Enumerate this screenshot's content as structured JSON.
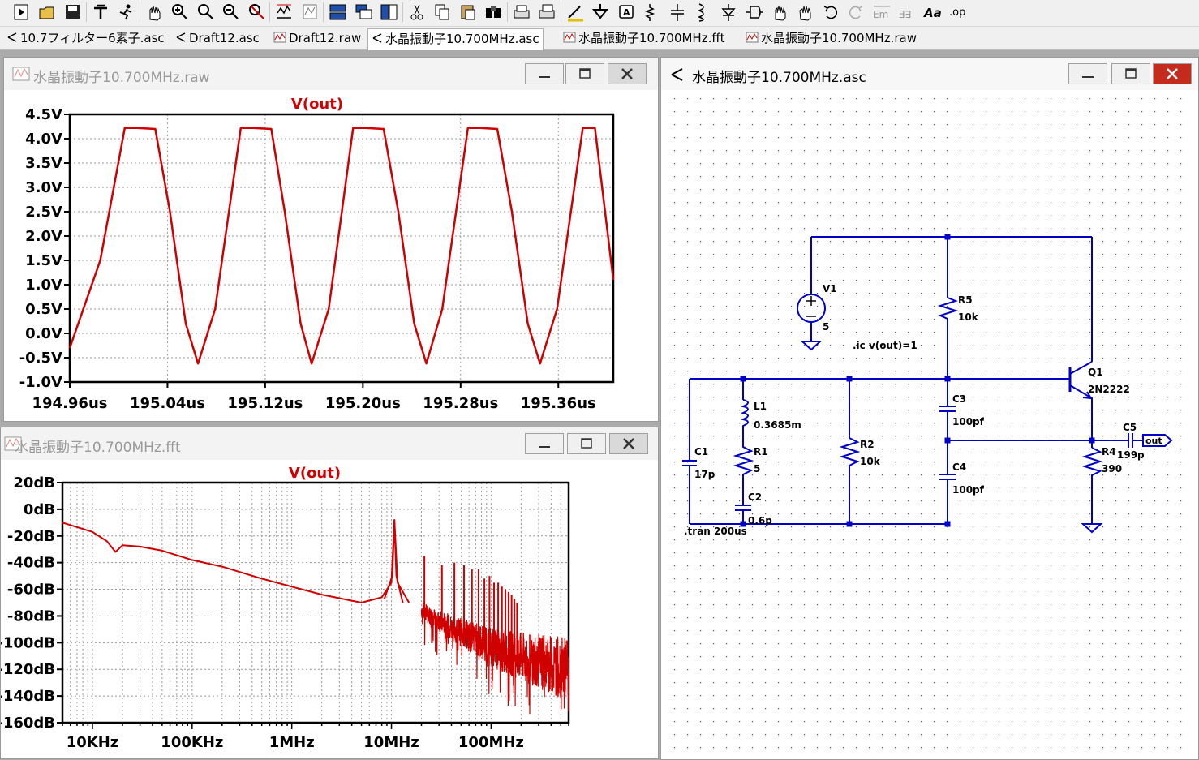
{
  "toolbar": {
    "buttons": [
      "run-icon",
      "open-icon",
      "save-icon",
      "control-panel-icon",
      "run-sim-icon",
      "pan-icon",
      "zoom-in-icon",
      "zoom-area-icon",
      "zoom-out-icon",
      "zoom-cancel-icon",
      "autorange-icon",
      "wave-icon",
      "tile-horizontal-icon",
      "cascade-icon",
      "tile-vertical-icon",
      "cut-icon",
      "copy-icon",
      "paste-icon",
      "find-icon",
      "print-icon",
      "print-setup-icon",
      "wire-icon",
      "ground-icon",
      "label-icon",
      "resistor-icon",
      "capacitor-icon",
      "inductor-icon",
      "diode-icon",
      "component-icon",
      "move-icon",
      "drag-icon",
      "undo-icon",
      "redo-icon",
      "rotate-icon",
      "mirror-icon",
      "text-icon",
      "spice-directive-icon"
    ],
    "text_label": "Aa",
    "op_label": ".op"
  },
  "tabs": [
    {
      "label": "10.7フィルター6素子.asc",
      "icon": "schematic-icon"
    },
    {
      "label": "Draft12.asc",
      "icon": "schematic-icon"
    },
    {
      "label": "Draft12.raw",
      "icon": "waveform-icon"
    },
    {
      "label": "水晶振動子10.700MHz.asc",
      "icon": "schematic-icon",
      "active": true
    },
    {
      "label": "水晶振動子10.700MHz.fft",
      "icon": "waveform-icon"
    },
    {
      "label": "水晶振動子10.700MHz.raw",
      "icon": "waveform-icon"
    }
  ],
  "raw_window": {
    "title": "水晶振動子10.700MHz.raw",
    "trace_label": "V(out)",
    "trace_color": "#d00000"
  },
  "fft_window": {
    "title": "水晶振動子10.700MHz.fft",
    "trace_label": "V(out)",
    "trace_color": "#d00000"
  },
  "schematic_window": {
    "title": "水晶振動子10.700MHz.asc",
    "wire_color": "#0000c8",
    "components": [
      {
        "ref": "V1",
        "value": "5"
      },
      {
        "ref": "R5",
        "value": "10k"
      },
      {
        "ref": "Q1",
        "value": "2N2222"
      },
      {
        "ref": "C3",
        "value": "100pf"
      },
      {
        "ref": "C4",
        "value": "100pf"
      },
      {
        "ref": "R4",
        "value": "390"
      },
      {
        "ref": "C5",
        "value": "199p"
      },
      {
        "ref": "L1",
        "value": "0.3685m"
      },
      {
        "ref": "R1",
        "value": "5"
      },
      {
        "ref": "C2",
        "value": "0.6p"
      },
      {
        "ref": "C1",
        "value": "17p"
      },
      {
        "ref": "R2",
        "value": "10k"
      }
    ],
    "directives": [
      ".ic v(out)=1",
      ".tran 200us"
    ],
    "net_label": "out"
  },
  "chart_data": [
    {
      "type": "line",
      "title": "V(out)",
      "xlabel": "",
      "ylabel": "",
      "x_ticks": [
        "194.96us",
        "195.04us",
        "195.12us",
        "195.20us",
        "195.28us",
        "195.36us"
      ],
      "y_ticks": [
        "4.5V",
        "4.0V",
        "3.5V",
        "3.0V",
        "2.5V",
        "2.0V",
        "1.5V",
        "1.0V",
        "0.5V",
        "0.0V",
        "-0.5V",
        "-1.0V"
      ],
      "xlim": [
        194.96,
        195.405
      ],
      "ylim": [
        -1.0,
        4.5
      ],
      "series": [
        {
          "name": "V(out)",
          "period_us": 0.0935,
          "high_v": 4.22,
          "low_v": -0.62,
          "x": [
            194.96,
            194.985,
            195.005,
            195.015,
            195.03,
            195.042,
            195.055,
            195.065,
            195.079,
            195.1,
            195.11,
            195.125,
            195.136,
            195.149,
            195.158,
            195.172,
            195.192,
            195.202,
            195.217,
            195.229,
            195.242,
            195.252,
            195.265,
            195.286,
            195.296,
            195.31,
            195.322,
            195.335,
            195.345,
            195.359,
            195.38,
            195.39,
            195.405
          ],
          "y": [
            -0.3,
            1.5,
            4.22,
            4.22,
            4.2,
            2.5,
            0.2,
            -0.62,
            0.5,
            4.22,
            4.22,
            4.2,
            2.5,
            0.2,
            -0.62,
            0.5,
            4.22,
            4.22,
            4.2,
            2.5,
            0.2,
            -0.62,
            0.5,
            4.22,
            4.22,
            4.2,
            2.5,
            0.2,
            -0.62,
            0.5,
            4.22,
            4.22,
            1.1
          ]
        }
      ]
    },
    {
      "type": "line",
      "title": "V(out)",
      "xlabel": "",
      "ylabel": "",
      "x_scale": "log",
      "x_ticks": [
        "10KHz",
        "100KHz",
        "1MHz",
        "10MHz",
        "100MHz"
      ],
      "y_ticks": [
        "20dB",
        "0dB",
        "-20dB",
        "-40dB",
        "-60dB",
        "-80dB",
        "-100dB",
        "-120dB",
        "-140dB",
        "-160dB"
      ],
      "xlim": [
        5000,
        600000000
      ],
      "ylim": [
        -160,
        20
      ],
      "series": [
        {
          "name": "V(out)",
          "x": [
            5000,
            10000,
            14000,
            17000,
            20000,
            30000,
            50000,
            100000,
            200000,
            500000,
            1000000,
            2000000,
            5000000,
            8000000,
            10000000,
            10700000,
            11500000,
            15000000,
            21000000,
            32000000,
            64000000,
            128000000,
            300000000,
            600000000
          ],
          "y": [
            -10,
            -17,
            -24,
            -32,
            -27,
            -28,
            -31,
            -38,
            -43,
            -52,
            -58,
            -64,
            -70,
            -66,
            -55,
            -8,
            -55,
            -70,
            -76,
            -85,
            -96,
            -106,
            -114,
            -120
          ],
          "harmonic_peaks_hz": [
            21400000,
            32100000,
            42800000,
            53500000,
            64200000,
            74900000,
            85600000,
            96300000,
            107000000,
            117700000,
            128400000,
            139100000,
            149800000,
            160500000,
            171200000,
            181900000
          ],
          "harmonic_peaks_db": [
            -35,
            -42,
            -40,
            -42,
            -45,
            -45,
            -52,
            -50,
            -55,
            -55,
            -58,
            -60,
            -62,
            -64,
            -67,
            -70
          ]
        }
      ]
    }
  ]
}
